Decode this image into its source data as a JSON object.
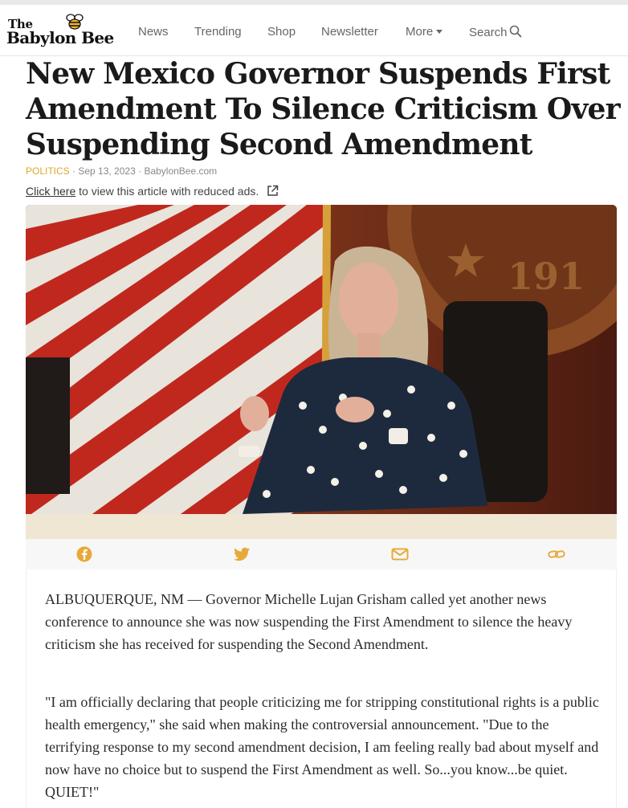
{
  "site": {
    "logo_line1": "The",
    "logo_line2": "Babylon Bee",
    "nav": [
      {
        "label": "News"
      },
      {
        "label": "Trending"
      },
      {
        "label": "Shop"
      },
      {
        "label": "Newsletter"
      },
      {
        "label": "More",
        "icon": "chevron-down-icon"
      },
      {
        "label": "Search",
        "icon": "search-icon"
      }
    ]
  },
  "article": {
    "headline": "New Mexico Governor Suspends First Amendment To Silence Criticism Over Suspending Second Amendment",
    "category": "POLITICS",
    "meta_sep": " · ",
    "date": "Sep 13, 2023",
    "source": "BabylonBee.com",
    "reduced_ads_link": "Click here",
    "reduced_ads_text": " to view this article with reduced ads.",
    "share_icons": [
      "facebook-icon",
      "twitter-icon",
      "email-icon",
      "link-icon"
    ],
    "paragraphs": [
      "ALBUQUERQUE, NM — Governor Michelle Lujan Grisham called yet another news conference to announce she was now suspending the First Amendment to silence the heavy criticism she has received for suspending the Second Amendment.",
      "\"I am officially declaring that people criticizing me for stripping constitutional rights is a public health emergency,\" she said when making the controversial announcement. \"Due to the terrifying response to my second amendment decision, I am feeling really bad about myself and now have no choice but to suspend the First Amendment as well. So...you know...be quiet. QUIET!\""
    ]
  },
  "colors": {
    "accent": "#e8a93a",
    "category": "#e0a82e",
    "text": "#1a1a1a"
  }
}
